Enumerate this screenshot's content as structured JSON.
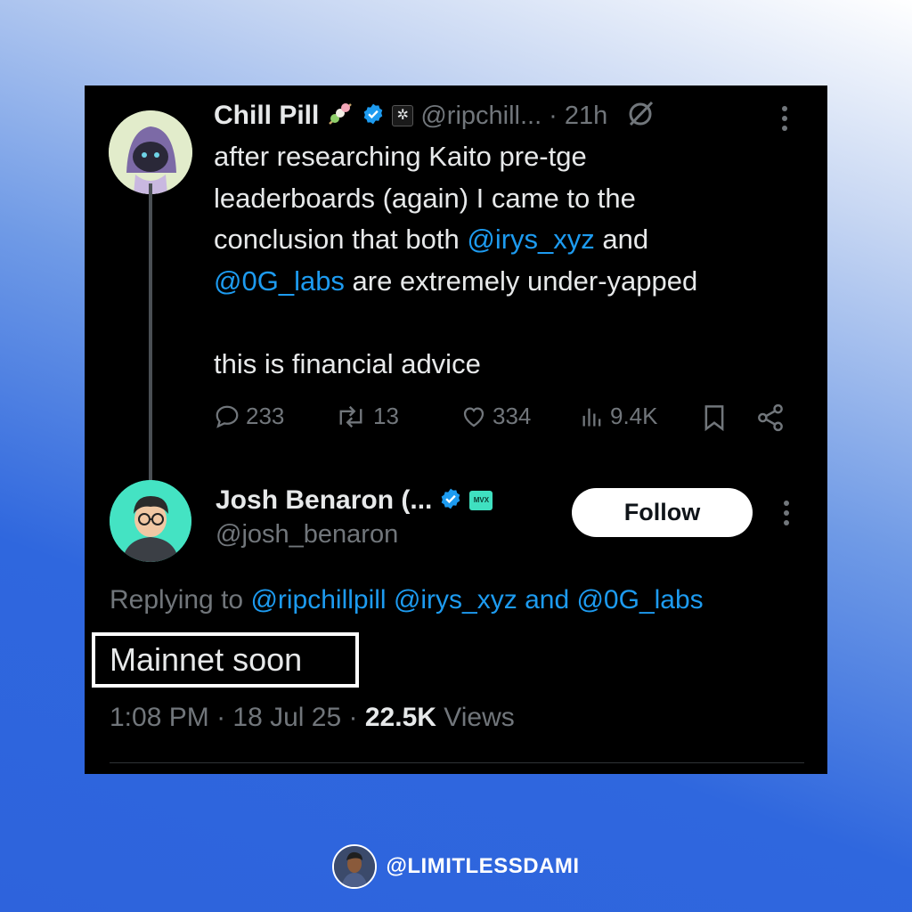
{
  "original_tweet": {
    "display_name": "Chill Pill",
    "handle": "@ripchill...",
    "separator": "·",
    "time_ago": "21h",
    "lines": [
      [
        "after researching Kaito pre-tge"
      ],
      [
        "leaderboards (again) I came to the"
      ],
      [
        "conclusion that both ",
        "@irys_xyz",
        " and"
      ],
      [
        "@0G_labs",
        " are extremely under-yapped"
      ],
      [
        ""
      ],
      [
        "this is financial advice"
      ]
    ],
    "line1": "after researching Kaito pre-tge",
    "line2": "leaderboards (again) I came to the",
    "line3_pre": "conclusion that both ",
    "line3_mention": "@irys_xyz",
    "line3_post": " and",
    "line4_mention": "@0G_labs",
    "line4_post": " are extremely under-yapped",
    "line6": "this is financial advice",
    "stats": {
      "replies": "233",
      "reposts": "13",
      "likes": "334",
      "views": "9.4K"
    },
    "icons": [
      "emoji-dango-icon",
      "verified-badge-icon",
      "affiliate-badge-icon",
      "grok-icon",
      "more-icon"
    ]
  },
  "reply_tweet": {
    "display_name": "Josh Benaron (...",
    "handle": "@josh_benaron",
    "follow_label": "Follow",
    "replying_to_prefix": "Replying to ",
    "replying_mention1": "@ripchillpill",
    "replying_mention2": "@irys_xyz",
    "replying_and": " and ",
    "replying_mention3": "@0G_labs",
    "text": "Mainnet soon",
    "time": "1:08 PM",
    "sep1": "·",
    "date": "18 Jul 25",
    "sep2": "·",
    "views_count": "22.5K",
    "views_label": " Views",
    "affiliate_badge_text": "MVX"
  },
  "footer": {
    "handle": "@LIMITLESSDAMI"
  },
  "colors": {
    "card_bg": "#000000",
    "text": "#e7e9ea",
    "muted": "#71767b",
    "link": "#1d9bf0",
    "verified": "#1d9bf0"
  }
}
